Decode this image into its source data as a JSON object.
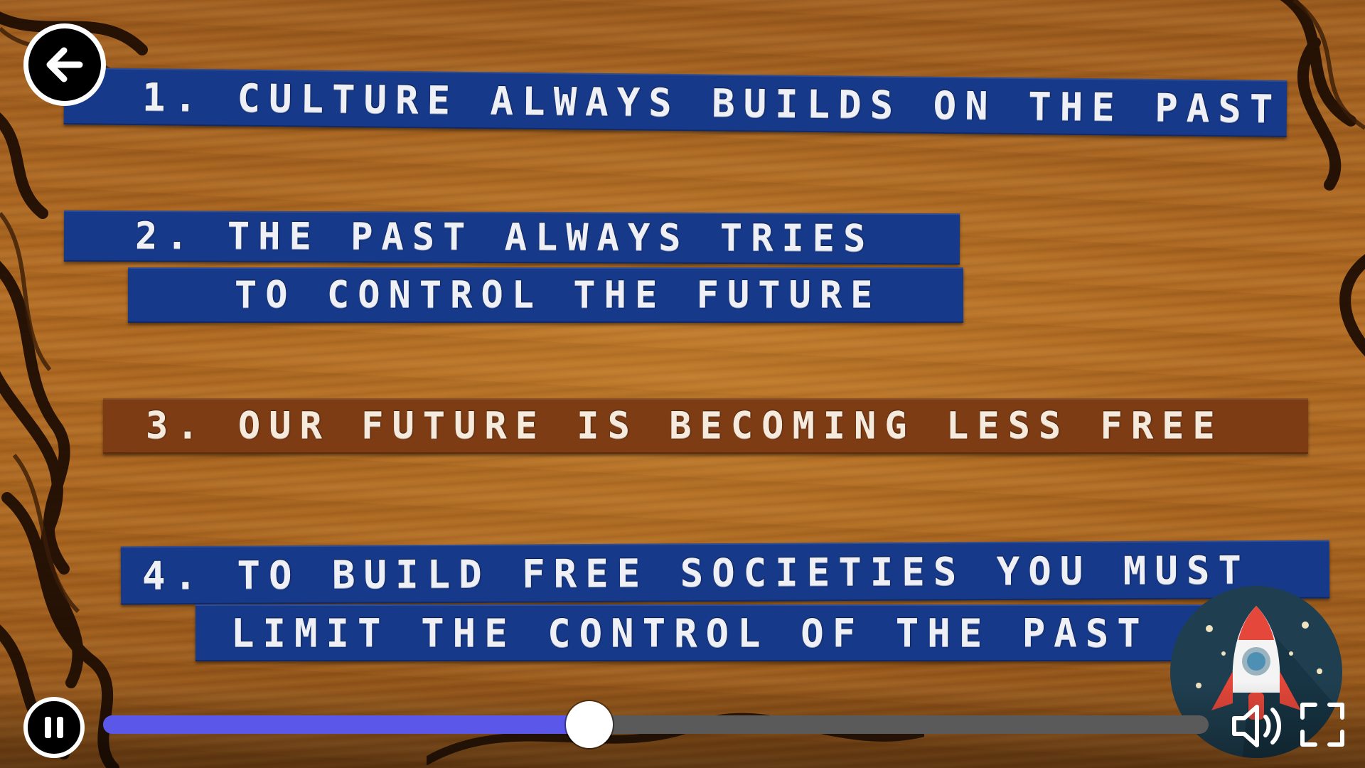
{
  "video": {
    "labels": [
      {
        "lines": [
          "1. CULTURE ALWAYS BUILDS ON THE PAST"
        ],
        "color": "blue"
      },
      {
        "lines": [
          "2. THE PAST ALWAYS TRIES",
          "TO CONTROL THE FUTURE"
        ],
        "color": "blue"
      },
      {
        "lines": [
          "3. OUR FUTURE IS BECOMING LESS FREE"
        ],
        "color": "brown"
      },
      {
        "lines": [
          "4. TO BUILD FREE SOCIETIES YOU MUST",
          "LIMIT THE CONTROL OF THE PAST"
        ],
        "color": "blue"
      }
    ],
    "colors": {
      "label_blue": "#17398a",
      "label_brown": "#7d3c14",
      "wood": "#a8641f"
    }
  },
  "player": {
    "back_icon": "arrow-left-icon",
    "pause_icon": "pause-icon",
    "volume_icon": "volume-icon",
    "fullscreen_icon": "fullscreen-icon",
    "progress_fraction": 0.44,
    "progress_color": "#5b57e8",
    "track_color": "#5a5a5a",
    "badge_icon": "rocket-icon"
  }
}
